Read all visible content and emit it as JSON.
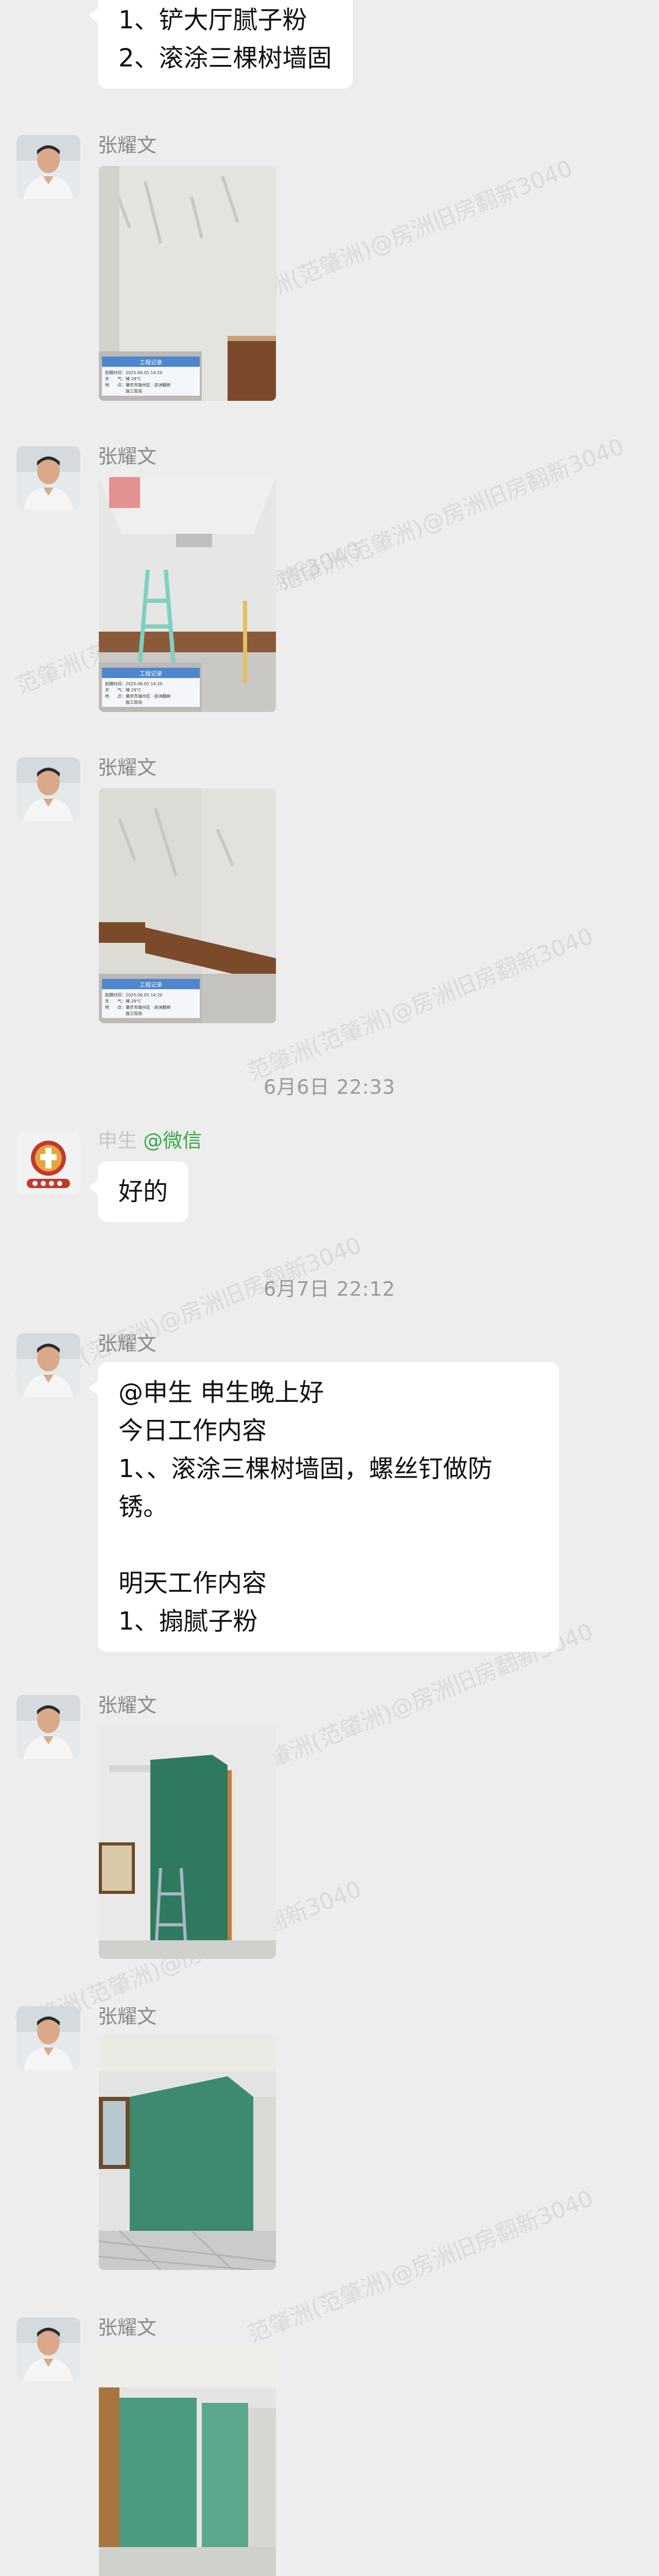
{
  "top_bubble": {
    "lines": [
      "1、铲大厅腻子粉",
      "2、滚涂三棵树墙固"
    ]
  },
  "messages": [
    {
      "sender": "张耀文"
    },
    {
      "sender": "张耀文"
    },
    {
      "sender": "张耀文"
    },
    {
      "timestamp": "6月6日 22:33"
    },
    {
      "sender": "申生",
      "sender_suffix": "@微信",
      "text": "好的"
    },
    {
      "timestamp": "6月7日 22:12"
    },
    {
      "sender": "张耀文",
      "lines": [
        "@申生 申生晚上好",
        "今日工作内容",
        "1、、滚涂三棵树墙固，螺丝钉做防",
        "锈。",
        "",
        "明天工作内容",
        "1、搧腻子粉"
      ]
    },
    {
      "sender": "张耀文"
    },
    {
      "sender": "张耀文"
    },
    {
      "sender": "张耀文"
    }
  ],
  "watermark_text": "范肇洲(范肇洲)@房洲旧房翻新3040",
  "photo_card": {
    "title": "工程记录",
    "rows": [
      "拍摄时间：2025.06.05 14:20",
      "天　　气：晴 29°C",
      "地　　点：肇庆市端州区 · 房洲翻新",
      "　　　　　施工现场"
    ]
  },
  "colors": {
    "background": "#ededed",
    "bubble": "#ffffff",
    "sender_name": "#8a8a8a",
    "wechat_suffix": "#39a843"
  },
  "icons": {
    "avatar_zhang": "person-avatar-icon",
    "avatar_shen": "brand-logo-avatar-icon"
  }
}
